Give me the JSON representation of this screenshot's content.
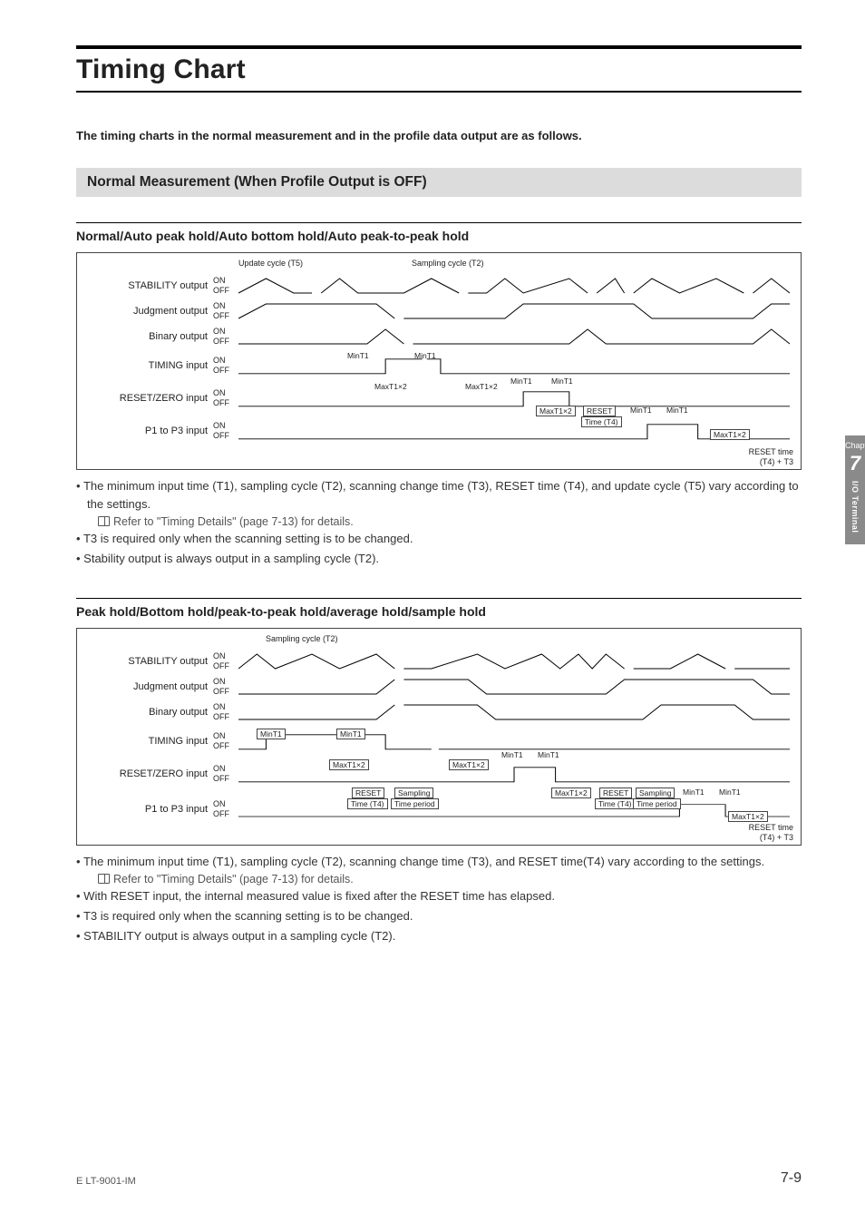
{
  "page": {
    "title": "Timing Chart",
    "lead": "The timing charts in the normal measurement and in the profile data output are as follows.",
    "footer_left": "E LT-9001-IM",
    "footer_right": "7-9"
  },
  "side_tab": {
    "chapter_label": "Chapter",
    "number": "7",
    "vertical_text": "I/O Terminal"
  },
  "section1": {
    "band": "Normal Measurement (When Profile Output is OFF)",
    "sub1": {
      "title": "Normal/Auto peak hold/Auto bottom hold/Auto peak-to-peak hold",
      "top_marker_left": "Update cycle (T5)",
      "top_marker_right": "Sampling cycle (T2)",
      "signals": [
        "STABILITY output",
        "Judgment output",
        "Binary output",
        "TIMING input",
        "RESET/ZERO input",
        "P1 to P3 input"
      ],
      "onoff": {
        "on": "ON",
        "off": "OFF"
      },
      "annots": {
        "min_t1": "MinT1",
        "max_t1x2": "MaxT1×2",
        "reset": "RESET",
        "time_t4": "Time (T4)",
        "reset_time": "RESET time",
        "reset_formula": "(T4) + T3"
      },
      "bullet1": "The minimum input time (T1), sampling cycle (T2), scanning change time (T3), RESET time (T4), and update cycle (T5) vary according to the settings.",
      "ref": "Refer to \"Timing Details\" (page 7-13) for details.",
      "bullet2": "T3 is required only when the scanning setting is to be changed.",
      "bullet3": "Stability output is always output in a sampling cycle (T2)."
    },
    "sub2": {
      "title": "Peak hold/Bottom hold/peak-to-peak hold/average hold/sample hold",
      "top_marker": "Sampling cycle (T2)",
      "signals": [
        "STABILITY output",
        "Judgment output",
        "Binary output",
        "TIMING input",
        "RESET/ZERO input",
        "P1 to P3 input"
      ],
      "onoff": {
        "on": "ON",
        "off": "OFF"
      },
      "annots": {
        "min_t1": "MinT1",
        "max_t1x2": "MaxT1×2",
        "reset": "RESET",
        "time_t4": "Time (T4)",
        "sampling": "Sampling",
        "time_period": "Time period",
        "reset_time": "RESET time",
        "reset_formula": "(T4) + T3"
      },
      "bullet1": "The minimum input time (T1), sampling cycle (T2), scanning change time (T3), and RESET time(T4) vary according to the settings.",
      "ref": "Refer to \"Timing Details\" (page 7-13) for details.",
      "bullet2": "With RESET input, the internal measured value is fixed after the RESET time has elapsed.",
      "bullet3": "T3 is required only when the scanning setting is to be changed.",
      "bullet4": "STABILITY output is always output in a sampling cycle (T2)."
    }
  },
  "chart_data": [
    {
      "type": "timing-diagram",
      "title": "Normal/Auto peak hold/Auto bottom hold/Auto peak-to-peak hold",
      "signals": [
        "STABILITY output",
        "Judgment output",
        "Binary output",
        "TIMING input",
        "RESET/ZERO input",
        "P1 to P3 input"
      ],
      "y_states": [
        "ON",
        "OFF"
      ],
      "time_params": [
        "Update cycle (T5)",
        "Sampling cycle (T2)",
        "MinT1",
        "MaxT1×2",
        "RESET",
        "Time (T4)",
        "RESET time = (T4) + T3"
      ]
    },
    {
      "type": "timing-diagram",
      "title": "Peak hold/Bottom hold/peak-to-peak hold/average hold/sample hold",
      "signals": [
        "STABILITY output",
        "Judgment output",
        "Binary output",
        "TIMING input",
        "RESET/ZERO input",
        "P1 to P3 input"
      ],
      "y_states": [
        "ON",
        "OFF"
      ],
      "time_params": [
        "Sampling cycle (T2)",
        "MinT1",
        "MaxT1×2",
        "RESET",
        "Time (T4)",
        "Sampling",
        "Time period",
        "RESET time = (T4) + T3"
      ]
    }
  ]
}
